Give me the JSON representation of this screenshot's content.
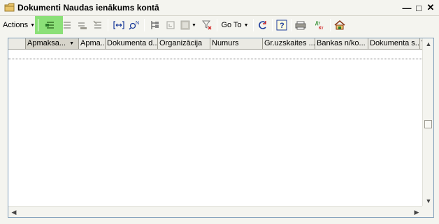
{
  "window": {
    "title": "Dokumenti Naudas ienākums kontā",
    "minimize_glyph": "—",
    "maximize_glyph": "□",
    "close_glyph": "✕"
  },
  "toolbar": {
    "actions_label": "Actions",
    "goto_label": "Go To",
    "dropdown_glyph": "▼",
    "help_glyph": "?",
    "highlight_color": "#8be078"
  },
  "grid": {
    "columns": [
      {
        "label": "Apmaksa..."
      },
      {
        "label": "Apma..."
      },
      {
        "label": "Dokumenta d..."
      },
      {
        "label": "Organizācija"
      },
      {
        "label": "Numurs"
      },
      {
        "label": "Gr.uzskaites ..."
      },
      {
        "label": "Bankas n/ko..."
      },
      {
        "label": "Dokumenta s..."
      },
      {
        "label": "V"
      }
    ],
    "sort_glyph": "▼"
  },
  "scroll": {
    "up": "▲",
    "down": "▼",
    "left": "◀",
    "right": "▶"
  }
}
